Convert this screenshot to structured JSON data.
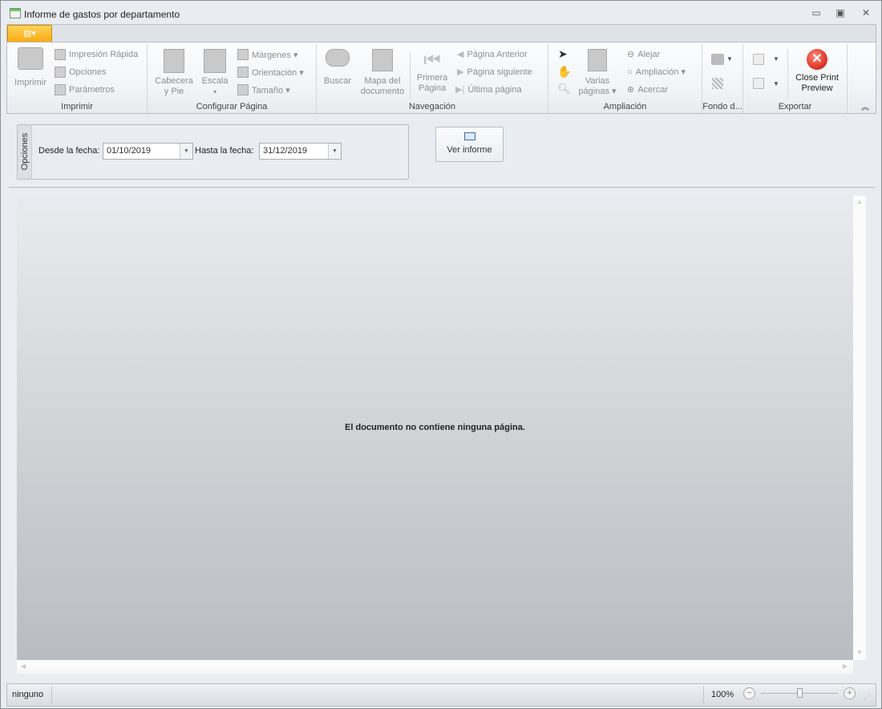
{
  "window": {
    "title": "Informe de gastos por departamento",
    "minimize": "▭",
    "maximize": "▣",
    "close": "✕"
  },
  "ribbon": {
    "app_button": "▤▾",
    "groups": {
      "imprimir": {
        "label": "Imprimir",
        "print": "Imprimir",
        "quick_print": "Impresión Rápida",
        "options": "Opciones",
        "parameters": "Parámetros"
      },
      "page_setup": {
        "label": "Configurar Página",
        "header_footer_1": "Cabecera",
        "header_footer_2": "y Pie",
        "scale": "Escala",
        "scale_arrow": "▾",
        "margins": "Márgenes ▾",
        "orientation": "Orientación ▾",
        "size": "Tamaño ▾"
      },
      "navigation": {
        "label": "Navegación",
        "find": "Buscar",
        "doc_map_1": "Mapa del",
        "doc_map_2": "documento",
        "first_1": "Primera",
        "first_2": "Página",
        "prev": "Página Anterior",
        "next": "Página siguiente",
        "last": "Última página"
      },
      "zoom": {
        "label": "Ampliación",
        "multi_1": "Varias",
        "multi_2": "páginas ▾",
        "zoom_out": "Alejar",
        "zoom": "Ampliación ▾",
        "zoom_in": "Acercar"
      },
      "background": {
        "label": "Fondo d..."
      },
      "export": {
        "label": "Exportar",
        "close_1": "Close Print",
        "close_2": "Preview"
      }
    },
    "collapse": "︽"
  },
  "options": {
    "panel_label": "Opciones",
    "from_label": "Desde la fecha:",
    "from_value": "01/10/2019",
    "to_label": "Hasta la fecha:",
    "to_value": "31/12/2019",
    "view_button": "Ver informe"
  },
  "preview": {
    "message": "El documento no contiene ninguna página."
  },
  "status": {
    "left": "ninguno",
    "zoom": "100%",
    "zoom_fraction": 0.5
  },
  "colors": {
    "accent": "#f8a90e",
    "close_red": "#e03a2a"
  }
}
